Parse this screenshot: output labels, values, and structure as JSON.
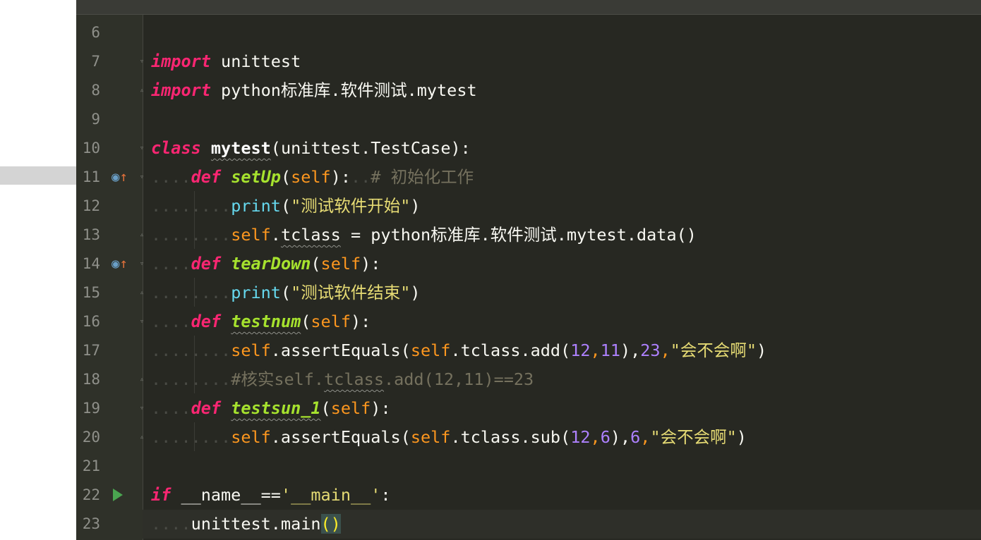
{
  "gutter": {
    "line_numbers": [
      "6",
      "7",
      "8",
      "9",
      "10",
      "11",
      "12",
      "13",
      "14",
      "15",
      "16",
      "17",
      "18",
      "19",
      "20",
      "21",
      "22",
      "23"
    ],
    "icons": {
      "override": "override-icon",
      "run": "run-icon",
      "fold": "fold-icon"
    }
  },
  "colors": {
    "background": "#272822",
    "keyword": "#f92672",
    "function": "#a6e22e",
    "self": "#fd971f",
    "string": "#e6db74",
    "number": "#ae81ff",
    "comment": "#75715e",
    "builtin": "#66d9ef"
  },
  "code": {
    "l7": {
      "kw": "import",
      "rest": "unittest"
    },
    "l8": {
      "kw": "import",
      "rest": "python标准库.软件测试.mytest"
    },
    "l10": {
      "kw": "class",
      "name": "mytest",
      "args": "(unittest.TestCase):"
    },
    "l11": {
      "kw": "def",
      "name": "setUp",
      "open": "(",
      "self": "self",
      "close": "):",
      "comment": "# 初始化工作"
    },
    "l12": {
      "fn": "print",
      "open": "(",
      "str": "\"测试软件开始\"",
      "close": ")"
    },
    "l13": {
      "self": "self",
      "dot": ".",
      "attr": "tclass",
      "rest": " = python标准库.软件测试.mytest.data()"
    },
    "l14": {
      "kw": "def",
      "name": "tearDown",
      "open": "(",
      "self": "self",
      "close": "):"
    },
    "l15": {
      "fn": "print",
      "open": "(",
      "str": "\"测试软件结束\"",
      "close": ")"
    },
    "l16": {
      "kw": "def",
      "name": "testnum",
      "open": "(",
      "self": "self",
      "close": "):"
    },
    "l17": {
      "self1": "self",
      "mid1": ".assertEquals(",
      "self2": "self",
      "mid2": ".tclass.add(",
      "n1": "12",
      "c1": ",",
      "n2": "11",
      "mid3": "),",
      "n3": "23",
      "c2": ",",
      "str": "\"会不会啊\"",
      "close": ")"
    },
    "l18": {
      "c1": "#核实self.",
      "c2": "tclass",
      "c3": ".add(12,11)==23"
    },
    "l19": {
      "kw": "def",
      "name": "testsun_1",
      "open": "(",
      "self": "self",
      "close": "):"
    },
    "l20": {
      "self1": "self",
      "mid1": ".assertEquals(",
      "self2": "self",
      "mid2": ".tclass.sub(",
      "n1": "12",
      "c1": ",",
      "n2": "6",
      "mid3": "),",
      "n3": "6",
      "c2": ",",
      "str": "\"会不会啊\"",
      "close": ")"
    },
    "l22": {
      "kw": "if",
      "mid": " __name__==",
      "str": "'__main__'",
      "close": ":"
    },
    "l23": {
      "rest": "unittest.main",
      "brk": "()"
    }
  }
}
